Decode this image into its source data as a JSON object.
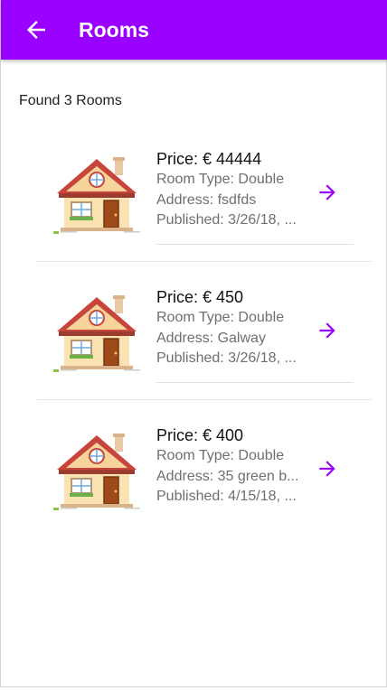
{
  "header": {
    "title": "Rooms",
    "back_icon": "arrow-left-icon",
    "color": "#9900ff"
  },
  "summary": "Found 3 Rooms",
  "rooms": [
    {
      "price": "Price: € 44444",
      "room_type": "Room Type: Double",
      "address": "Address: fsdfds",
      "published": "Published: 3/26/18, ...",
      "icon": "house-icon"
    },
    {
      "price": "Price: € 450",
      "room_type": "Room Type: Double",
      "address": "Address: Galway",
      "published": "Published: 3/26/18, ...",
      "icon": "house-icon"
    },
    {
      "price": "Price: € 400",
      "room_type": "Room Type: Double",
      "address": "Address: 35 green b...",
      "published": "Published: 4/15/18, ...",
      "icon": "house-icon"
    }
  ],
  "accent": "#9900ff"
}
